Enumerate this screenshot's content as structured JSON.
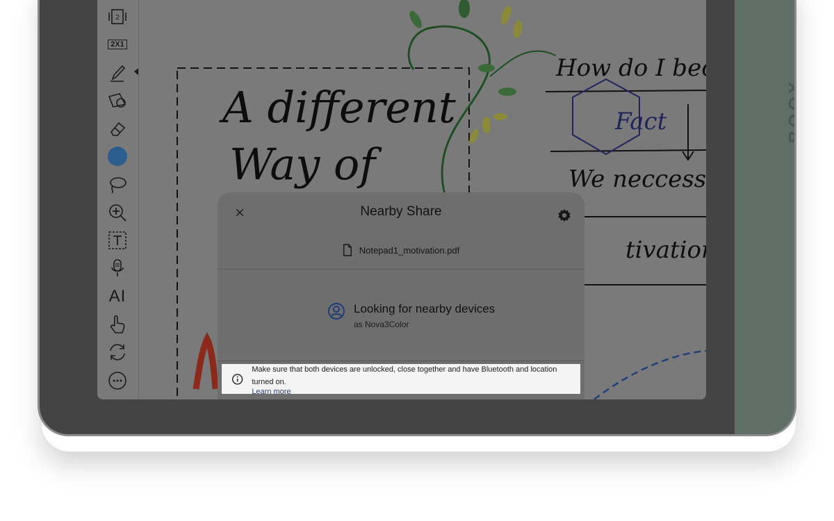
{
  "device": {
    "brand": "BOOX"
  },
  "toolbar": {
    "layout_label": "2",
    "split_label": "2X1",
    "ai_label": "AI",
    "pen_color": "#2b5d8f"
  },
  "canvas": {
    "line1": "How do I become",
    "fact": "Fact",
    "line2": "We neccessarily",
    "line3": "tivation",
    "big1": "A different",
    "big2": "Way of"
  },
  "share": {
    "title": "Nearby Share",
    "file_name": "Notepad1_motivation.pdf",
    "searching_title": "Looking for nearby devices",
    "searching_sub": "as Nova3Color"
  },
  "banner": {
    "message": "Make sure that both devices are unlocked, close together and have Bluetooth and location turned on.",
    "link": "Learn more"
  }
}
